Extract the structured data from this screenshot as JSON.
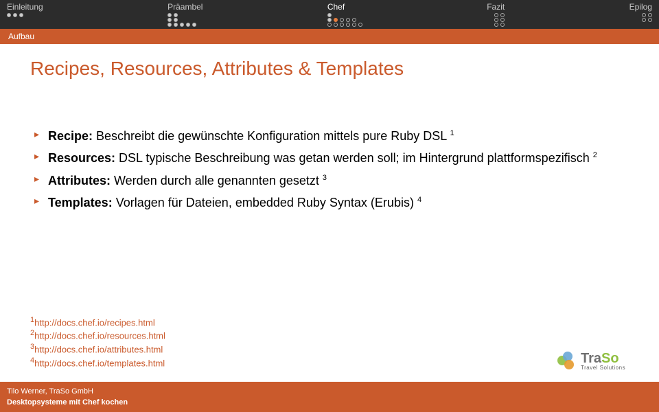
{
  "nav": {
    "sections": [
      {
        "label": "Einleitung",
        "active": false,
        "dot_rows": [
          [
            1,
            1,
            1
          ]
        ]
      },
      {
        "label": "Präambel",
        "active": false,
        "dot_rows": [
          [
            1,
            1
          ],
          [
            1,
            1
          ],
          [
            1,
            1,
            1,
            1,
            1
          ]
        ]
      },
      {
        "label": "Chef",
        "active": true,
        "dot_rows": [
          [
            1
          ],
          [
            1,
            1,
            1,
            1,
            1
          ],
          [
            1,
            1,
            1,
            1,
            1,
            1
          ]
        ],
        "current_row": 1,
        "current_col": 1
      },
      {
        "label": "Fazit",
        "active": false,
        "dot_rows": [
          [
            0,
            0
          ],
          [
            0,
            0
          ],
          [
            0,
            0
          ]
        ]
      },
      {
        "label": "Epilog",
        "active": false,
        "dot_rows": [
          [
            0,
            0
          ],
          [
            0,
            0
          ]
        ]
      }
    ]
  },
  "subtitle": "Aufbau",
  "title": "Recipes, Resources, Attributes & Templates",
  "bullets": [
    {
      "term": "Recipe:",
      "text": " Beschreibt die gewünschte Konfiguration mittels pure Ruby DSL ",
      "sup": "1"
    },
    {
      "term": "Resources:",
      "text": " DSL typische Beschreibung was getan werden soll; im Hintergrund plattformspezifisch ",
      "sup": "2"
    },
    {
      "term": "Attributes:",
      "text": " Werden durch alle genannten gesetzt ",
      "sup": "3"
    },
    {
      "term": "Templates:",
      "text": " Vorlagen für Dateien, embedded Ruby Syntax (Erubis) ",
      "sup": "4"
    }
  ],
  "footnotes": [
    {
      "sup": "1",
      "text": "http://docs.chef.io/recipes.html"
    },
    {
      "sup": "2",
      "text": "http://docs.chef.io/resources.html"
    },
    {
      "sup": "3",
      "text": "http://docs.chef.io/attributes.html"
    },
    {
      "sup": "4",
      "text": "http://docs.chef.io/templates.html"
    }
  ],
  "footer": {
    "author": "Tilo Werner, TraSo GmbH",
    "talk": "Desktopsysteme mit Chef kochen"
  },
  "logo": {
    "brand_a": "Tra",
    "brand_b": "So",
    "tagline": "Travel Solutions"
  }
}
